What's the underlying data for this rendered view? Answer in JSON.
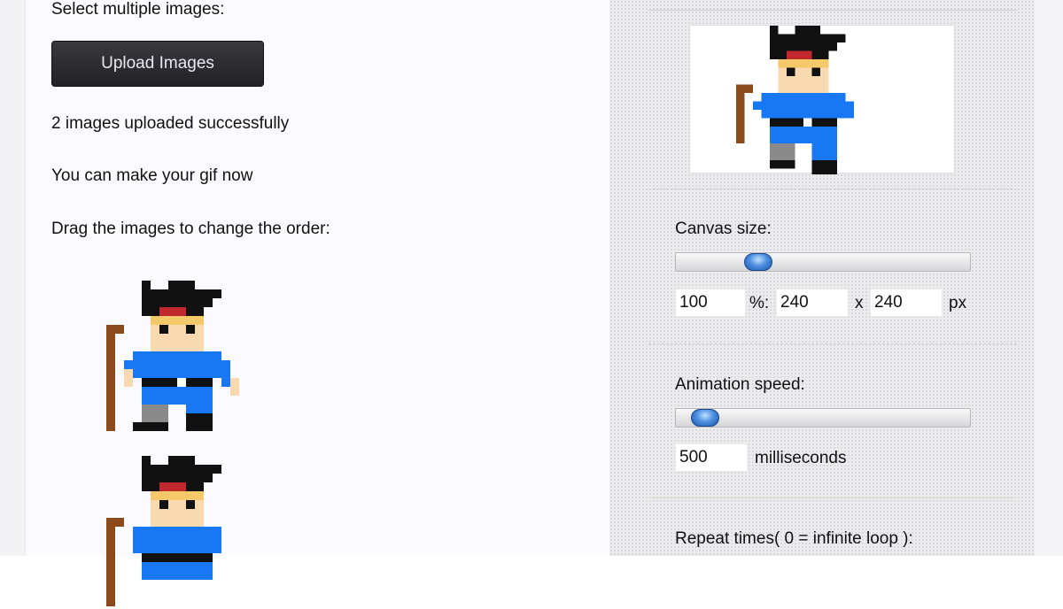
{
  "left": {
    "select_label": "Select multiple images:",
    "upload_button": "Upload Images",
    "status": "2 images uploaded successfully",
    "hint": "You can make your gif now",
    "drag_hint": "Drag the images to change the order:"
  },
  "right": {
    "canvas": {
      "label": "Canvas size:",
      "slider_value": 100,
      "percent_value": "100",
      "percent_suffix": "%:",
      "width_value": "240",
      "x_sep": "x",
      "height_value": "240",
      "unit": "px"
    },
    "speed": {
      "label": "Animation speed:",
      "value": "500",
      "unit": "milliseconds"
    },
    "repeat": {
      "label": "Repeat times( 0 = infinite loop ):"
    }
  },
  "colors": {
    "upload_button_bg": "#2b2b2f",
    "slider_knob": "#3f7fd4",
    "sprite_blue": "#1877f2",
    "sprite_hat": "#111111",
    "sprite_skin": "#f9d9b0",
    "sprite_hair": "#f5c96a",
    "sprite_staff": "#8b4a1c"
  },
  "icons": [
    "pixel-character-sprite"
  ]
}
